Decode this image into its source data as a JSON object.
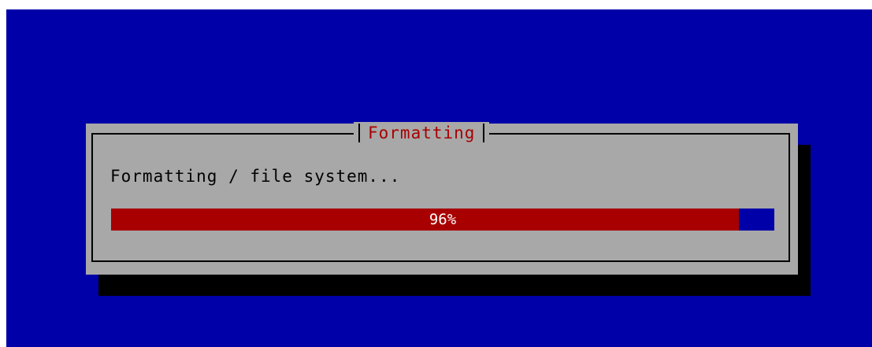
{
  "dialog": {
    "title": "Formatting",
    "message": "Formatting / file system..."
  },
  "progress": {
    "value": 0.946,
    "label": "96%"
  },
  "colors": {
    "screen_background": "#0000a8",
    "dialog_background": "#a8a8a8",
    "title_text": "#a80000",
    "progress_fill": "#a80000",
    "progress_track": "#0000a8",
    "progress_text": "#ffffff"
  }
}
